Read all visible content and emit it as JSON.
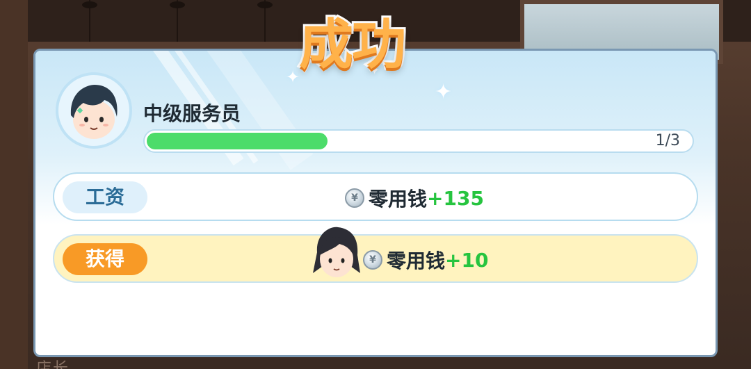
{
  "background": {
    "bottom_text": "店长"
  },
  "header": {
    "title": "成功"
  },
  "rank": {
    "name": "中级服务员",
    "progress_text": "1/3",
    "progress_fraction": 0.333
  },
  "rewards": [
    {
      "tag": "工资",
      "currency": "零用钱",
      "amount": "+135",
      "icon": "silver-coin-icon"
    },
    {
      "tag": "获得",
      "currency": "零用钱",
      "amount": "+10",
      "icon": "silver-coin-icon"
    }
  ],
  "colors": {
    "accent": "#f89a26",
    "progress": "#4cdc6a",
    "amount": "#26c43f",
    "title": "#ffb24a"
  }
}
